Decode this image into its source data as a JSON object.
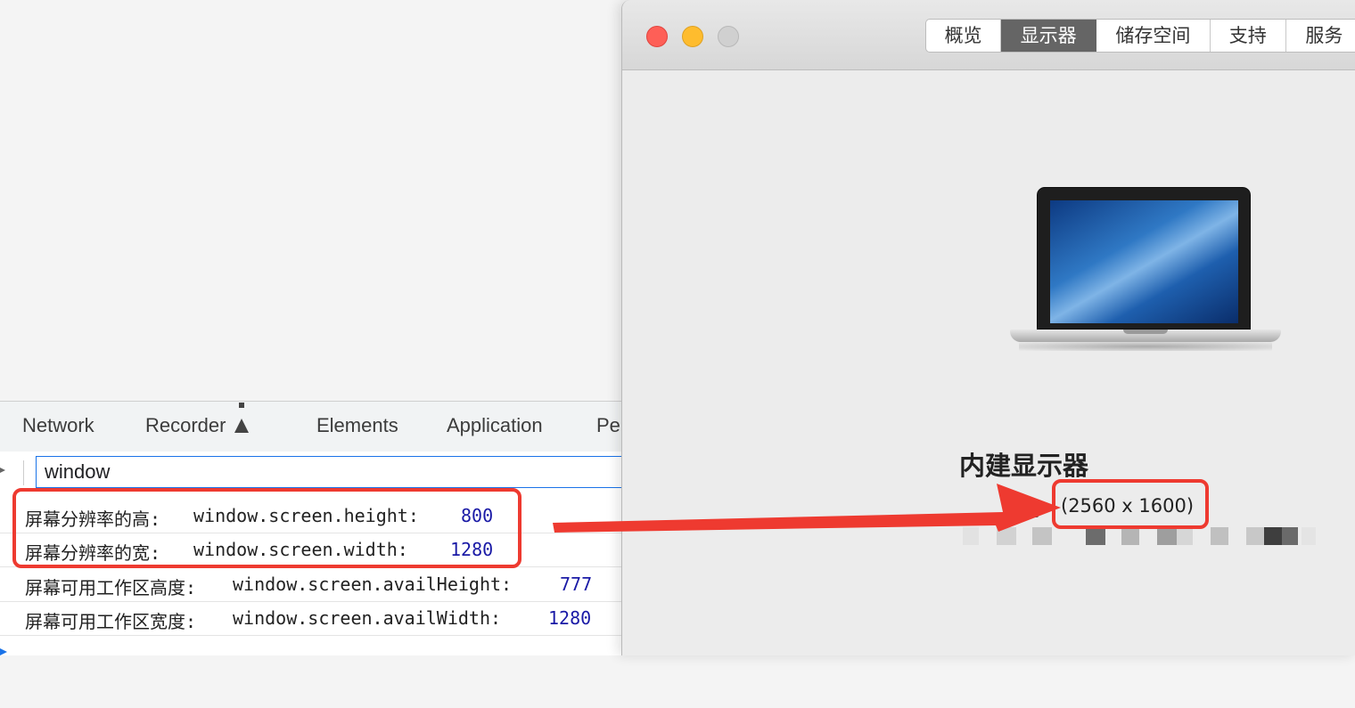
{
  "devtools": {
    "tabs": [
      "Network",
      "Recorder",
      "Elements",
      "Application",
      "Pe"
    ],
    "filter_value": "window",
    "log_rows": [
      {
        "label": "屏幕分辨率的高:",
        "expr": "window.screen.height:",
        "value": "800"
      },
      {
        "label": "屏幕分辨率的宽:",
        "expr": "window.screen.width:",
        "value": "1280"
      },
      {
        "label": "屏幕可用工作区高度:",
        "expr": "window.screen.availHeight:",
        "value": "777"
      },
      {
        "label": "屏幕可用工作区宽度:",
        "expr": "window.screen.availWidth:",
        "value": "1280"
      }
    ]
  },
  "about_mac": {
    "tabs": [
      "概览",
      "显示器",
      "储存空间",
      "支持",
      "服务"
    ],
    "active_tab": "显示器",
    "display_name": "内建显示器",
    "size_label": "寸",
    "resolution": "(2560 x 1600)",
    "traffic_lights": {
      "close": "#fe5f57",
      "minimize": "#febc2e",
      "zoom": "#d0d0d0"
    }
  },
  "annotation": {
    "color": "#ee3a30"
  }
}
